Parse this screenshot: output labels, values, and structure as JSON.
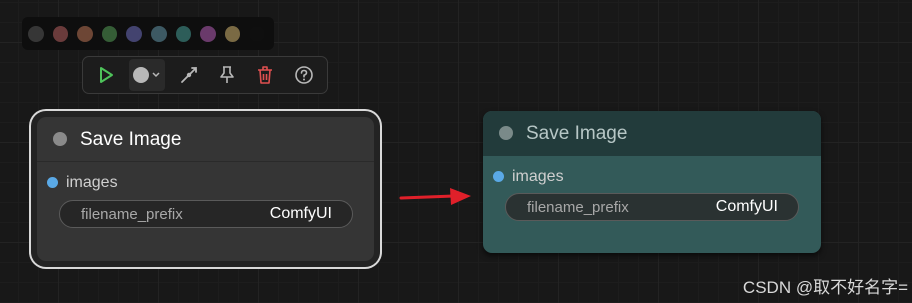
{
  "palette": {
    "colors": [
      "#363636",
      "#6a3b3b",
      "#6d4635",
      "#355d36",
      "#43436f",
      "#3d5963",
      "#2d5d59",
      "#6a3a6b",
      "#7a6a44",
      "#0f0f0f"
    ]
  },
  "toolbar": {
    "buttons": [
      {
        "icon": "play-icon",
        "color": "#4ec25a"
      },
      {
        "icon": "color-picker-icon",
        "color": "#b8b8b8"
      },
      {
        "icon": "bypass-icon",
        "color": "#b8b8b8"
      },
      {
        "icon": "pin-icon",
        "color": "#b8b8b8"
      },
      {
        "icon": "trash-icon",
        "color": "#e05050"
      },
      {
        "icon": "help-icon",
        "color": "#b8b8b8"
      }
    ]
  },
  "node_before": {
    "title": "Save Image",
    "input_label": "images",
    "widget_name": "filename_prefix",
    "widget_value": "ComfyUI",
    "colors": {
      "body": "#353535",
      "title_text": "#ffffff"
    }
  },
  "node_after": {
    "title": "Save Image",
    "input_label": "images",
    "widget_name": "filename_prefix",
    "widget_value": "ComfyUI",
    "colors": {
      "body": "#335a59",
      "header": "#223b3b",
      "title_text": "#b7c7c6"
    }
  },
  "arrow_color": "#e0202a",
  "watermark": "CSDN @取不好名字="
}
